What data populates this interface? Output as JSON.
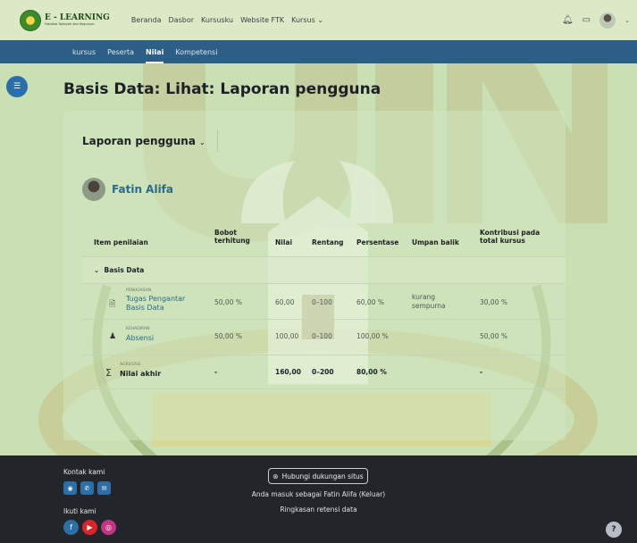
{
  "brand": {
    "title": "E - LEARNING",
    "subtitle": "Fakultas Tarbiyah dan Keguruan"
  },
  "topnav": [
    "Beranda",
    "Dasbor",
    "Kursusku",
    "Website FTK",
    "Kursus"
  ],
  "subnav": {
    "items": [
      "kursus",
      "Peserta",
      "Nilai",
      "Kompetensi"
    ],
    "active": "Nilai"
  },
  "page": {
    "title": "Basis Data: Lihat: Laporan pengguna"
  },
  "report": {
    "selector": "Laporan pengguna",
    "user_name": "Fatin Alifa"
  },
  "table": {
    "headers": {
      "item": "Item penilaian",
      "weight": "Bobot terhitung",
      "grade": "Nilai",
      "range": "Rentang",
      "percent": "Persentase",
      "feedback": "Umpan balik",
      "contribution": "Kontribusi pada total kursus"
    },
    "category": "Basis Data",
    "rows": [
      {
        "type": "PENUGASAN",
        "name": "Tugas Pengantar Basis Data",
        "weight": "50,00 %",
        "grade": "60,00",
        "range": "0–100",
        "percent": "60,00 %",
        "feedback": "kurang sempurna",
        "contribution": "30,00 %"
      },
      {
        "type": "KEHADIRAN",
        "name": "Absensi",
        "weight": "50,00 %",
        "grade": "100,00",
        "range": "0–100",
        "percent": "100,00 %",
        "feedback": "",
        "contribution": "50,00 %"
      }
    ],
    "total": {
      "type": "AGREGASI",
      "name": "Nilai akhir",
      "weight": "-",
      "grade": "160,00",
      "range": "0–200",
      "percent": "80,00 %",
      "contribution": "-"
    }
  },
  "footer": {
    "contact_label": "Kontak kami",
    "follow_label": "Ikuti kami",
    "support_button": "Hubungi dukungan situs",
    "logged_in_prefix": "Anda masuk sebagai Fatin Alifa",
    "logout_link": "(Keluar)",
    "retention": "Ringkasan retensi data",
    "help": "?"
  },
  "watermark": {
    "arabic": "جامعة الرانري",
    "latin": "A R - R A N I R Y"
  },
  "colors": {
    "navbar": "#dde9c6",
    "subnav": "#2b5f86",
    "footer": "#22262a",
    "link": "#2a6a8e"
  }
}
